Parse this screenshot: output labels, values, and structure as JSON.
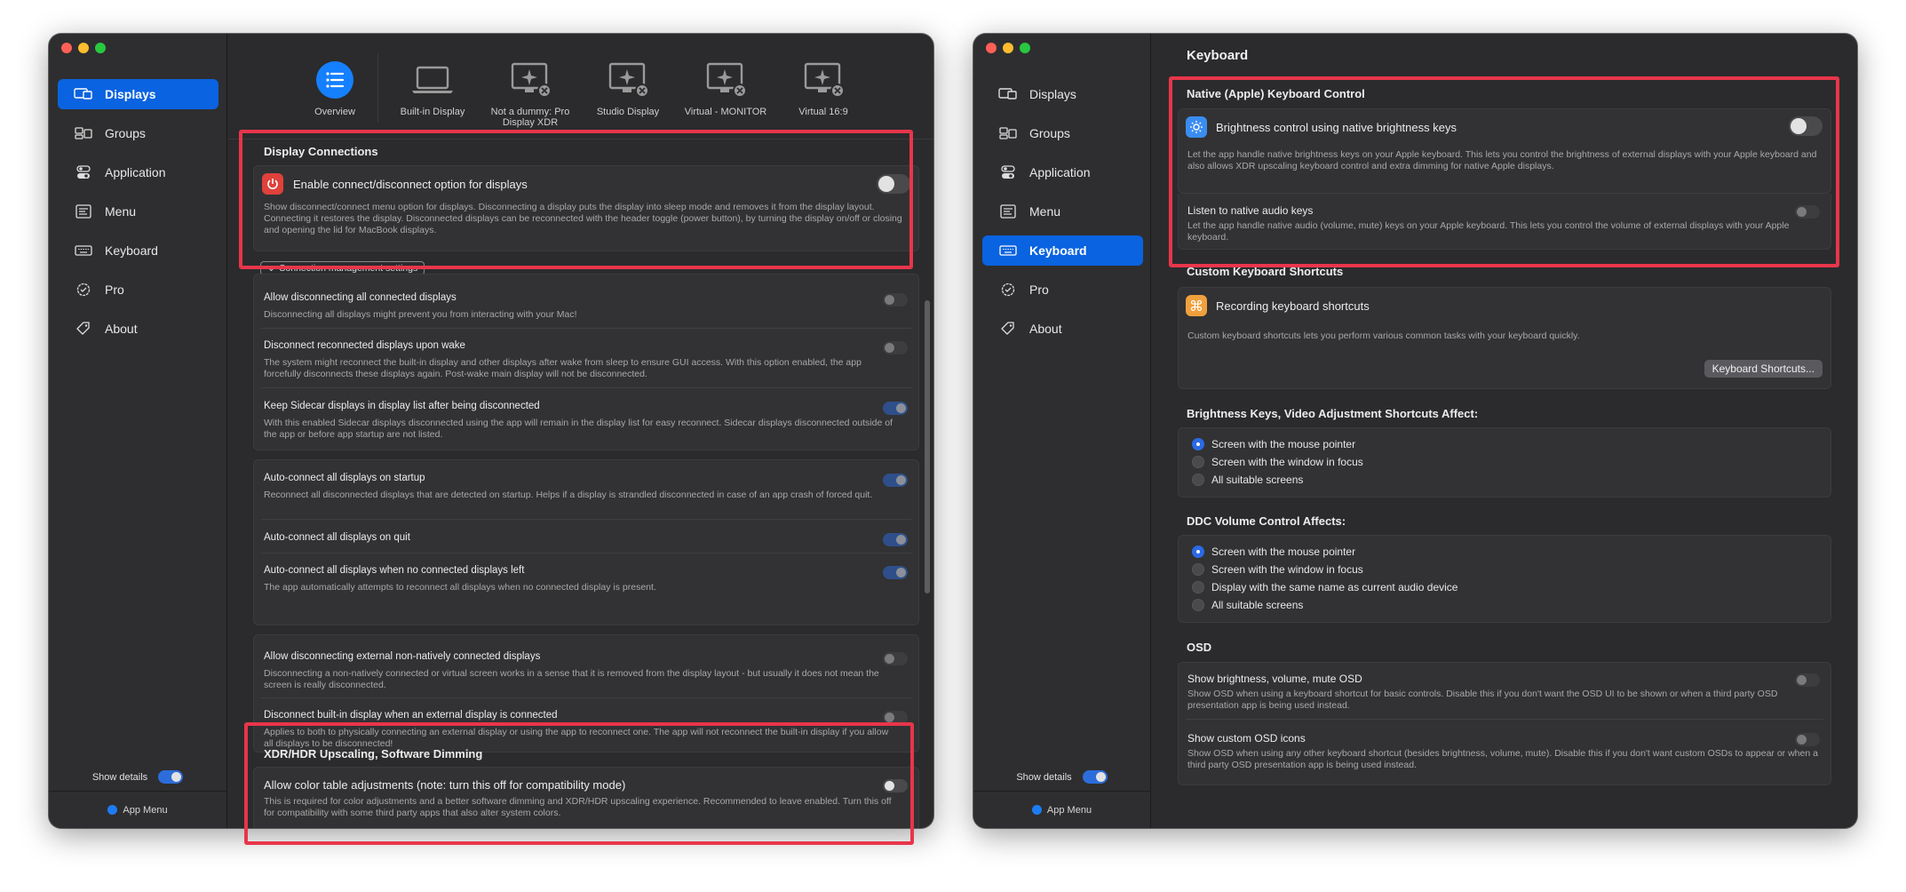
{
  "left": {
    "sidebar": {
      "items": [
        {
          "label": "Displays",
          "icon": "displays-icon"
        },
        {
          "label": "Groups",
          "icon": "groups-icon"
        },
        {
          "label": "Application",
          "icon": "application-icon"
        },
        {
          "label": "Menu",
          "icon": "menu-icon"
        },
        {
          "label": "Keyboard",
          "icon": "keyboard-icon"
        },
        {
          "label": "Pro",
          "icon": "pro-badge-icon"
        },
        {
          "label": "About",
          "icon": "tag-icon"
        }
      ],
      "active": "Displays",
      "show_details_label": "Show details",
      "show_details_on": true,
      "app_menu_label": "App Menu"
    },
    "toolbar": {
      "displays": [
        {
          "label": "Overview",
          "icon": "list-icon"
        },
        {
          "label": "Built-in Display",
          "icon": "laptop-icon"
        },
        {
          "label": "Not a dummy: Pro Display XDR",
          "icon": "virtual-display-icon"
        },
        {
          "label": "Studio Display",
          "icon": "virtual-display-icon"
        },
        {
          "label": "Virtual - MONITOR",
          "icon": "virtual-display-icon"
        },
        {
          "label": "Virtual 16:9",
          "icon": "virtual-display-icon"
        }
      ]
    },
    "display_connections": {
      "title": "Display Connections",
      "enable_label": "Enable connect/disconnect option for displays",
      "enable_desc": "Show disconnect/connect menu option for displays. Disconnecting a display puts the display into sleep mode and removes it from the display layout. Connecting it restores the display. Disconnected displays can be reconnected with the header toggle (power button), by turning the display on/off or closing and opening the lid for MacBook displays.",
      "settings_disclosure": "Connection management settings"
    },
    "settings": [
      {
        "title": "Allow disconnecting all connected displays",
        "desc": "Disconnecting all displays might prevent you from interacting with your Mac!",
        "on": false
      },
      {
        "title": "Disconnect reconnected displays upon wake",
        "desc": "The system might reconnect the built-in display and other displays after wake from sleep to ensure GUI access. With this option enabled, the app forcefully disconnects these displays again. Post-wake main display will not be disconnected.",
        "on": false
      },
      {
        "title": "Keep Sidecar displays in display list after being disconnected",
        "desc": "With this enabled Sidecar displays disconnected using the app will remain in the display list for easy reconnect. Sidecar displays disconnected outside of the app or before app startup are not listed.",
        "on": true
      },
      {
        "title": "Auto-connect all displays on startup",
        "desc": "Reconnect all disconnected displays that are detected on startup. Helps if a display is strandled disconnected in case of an app crash of forced quit.",
        "on": true
      },
      {
        "title": "Auto-connect all displays on quit",
        "desc": "",
        "on": true
      },
      {
        "title": "Auto-connect all displays when no connected displays left",
        "desc": "The app automatically attempts to reconnect all displays when no connected display is present.",
        "on": true
      },
      {
        "title": "Allow disconnecting external non-natively connected displays",
        "desc": "Disconnecting a non-natively connected or virtual screen works in a sense that it is removed from the display layout - but usually it does not mean the screen is really disconnected.",
        "on": false
      },
      {
        "title": "Disconnect built-in display when an external display is connected",
        "desc": "Applies to both to physically connecting an external display or using the app to reconnect one. The app will not reconnect the built-in display if you allow all displays to be disconnected!",
        "on": false
      }
    ],
    "xdr": {
      "title": "XDR/HDR Upscaling, Software Dimming",
      "color_table_label": "Allow color table adjustments (note: turn this off for compatibility mode)",
      "color_table_desc": "This is required for color adjustments and a better software dimming and XDR/HDR upscaling experience. Recommended to leave enabled. Turn this off for compatibility with some third party apps that also alter system colors.",
      "on": false
    }
  },
  "right": {
    "sidebar": {
      "items": [
        {
          "label": "Displays",
          "icon": "displays-icon"
        },
        {
          "label": "Groups",
          "icon": "groups-icon"
        },
        {
          "label": "Application",
          "icon": "application-icon"
        },
        {
          "label": "Menu",
          "icon": "menu-icon"
        },
        {
          "label": "Keyboard",
          "icon": "keyboard-icon"
        },
        {
          "label": "Pro",
          "icon": "pro-badge-icon"
        },
        {
          "label": "About",
          "icon": "tag-icon"
        }
      ],
      "active": "Keyboard",
      "show_details_label": "Show details",
      "show_details_on": true,
      "app_menu_label": "App Menu"
    },
    "page_title": "Keyboard",
    "native": {
      "title": "Native (Apple) Keyboard Control",
      "brightness_label": "Brightness control using native brightness keys",
      "brightness_desc": "Let the app handle native brightness keys on your Apple keyboard. This lets you control the brightness of external displays with your Apple keyboard and also allows XDR upscaling keyboard control and extra dimming for native Apple displays.",
      "audio_label": "Listen to native audio keys",
      "audio_desc": "Let the app handle native audio (volume, mute) keys on your Apple keyboard. This lets you control the volume of external displays with your Apple keyboard."
    },
    "custom": {
      "title": "Custom Keyboard Shortcuts",
      "recording_label": "Recording keyboard shortcuts",
      "recording_desc": "Custom keyboard shortcuts lets you perform various common tasks with your keyboard quickly.",
      "button": "Keyboard Shortcuts..."
    },
    "brightness_keys": {
      "title": "Brightness Keys, Video Adjustment Shortcuts Affect:",
      "options": [
        "Screen with the mouse pointer",
        "Screen with the window in focus",
        "All suitable screens"
      ],
      "selected": 0
    },
    "ddc_volume": {
      "title": "DDC Volume Control Affects:",
      "options": [
        "Screen with the mouse pointer",
        "Screen with the window in focus",
        "Display with the same name as current audio device",
        "All suitable screens"
      ],
      "selected": 0
    },
    "osd": {
      "title": "OSD",
      "show_label": "Show brightness, volume, mute OSD",
      "show_desc": "Show OSD when using a keyboard shortcut for basic controls. Disable this if you don't want the OSD UI to be shown or when a third party OSD presentation app is being used instead.",
      "custom_label": "Show custom OSD icons",
      "custom_desc": "Show OSD when using any other keyboard shortcut (besides brightness, volume, mute). Disable this if you don't want custom OSDs to appear or when a third party OSD presentation app is being used instead."
    }
  },
  "colors": {
    "accent": "#0a63e0",
    "highlight": "#e8354a",
    "window_bg": "#2b2b2d"
  }
}
